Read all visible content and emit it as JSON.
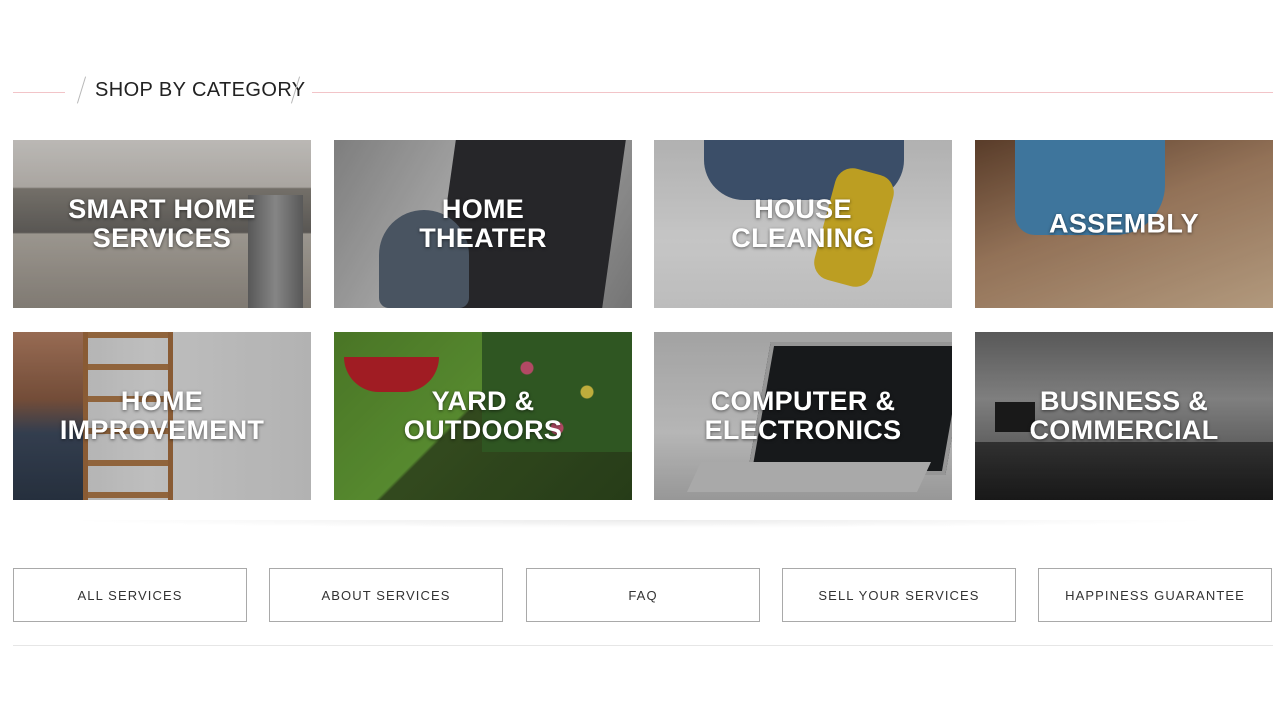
{
  "section": {
    "title": "SHOP BY CATEGORY"
  },
  "categories": [
    {
      "label": "SMART HOME\nSERVICES"
    },
    {
      "label": "HOME\nTHEATER"
    },
    {
      "label": "HOUSE\nCLEANING"
    },
    {
      "label": "ASSEMBLY"
    },
    {
      "label": "HOME\nIMPROVEMENT"
    },
    {
      "label": "YARD &\nOUTDOORS"
    },
    {
      "label": "COMPUTER &\nELECTRONICS"
    },
    {
      "label": "BUSINESS &\nCOMMERCIAL"
    }
  ],
  "nav": {
    "buttons": [
      {
        "label": "ALL SERVICES"
      },
      {
        "label": "ABOUT SERVICES"
      },
      {
        "label": "FAQ"
      },
      {
        "label": "SELL YOUR SERVICES"
      },
      {
        "label": "HAPPINESS GUARANTEE"
      }
    ]
  },
  "colors": {
    "header_rule": "#f2c4c8",
    "button_border": "#a9a9a9",
    "tile_text": "#ffffff"
  }
}
